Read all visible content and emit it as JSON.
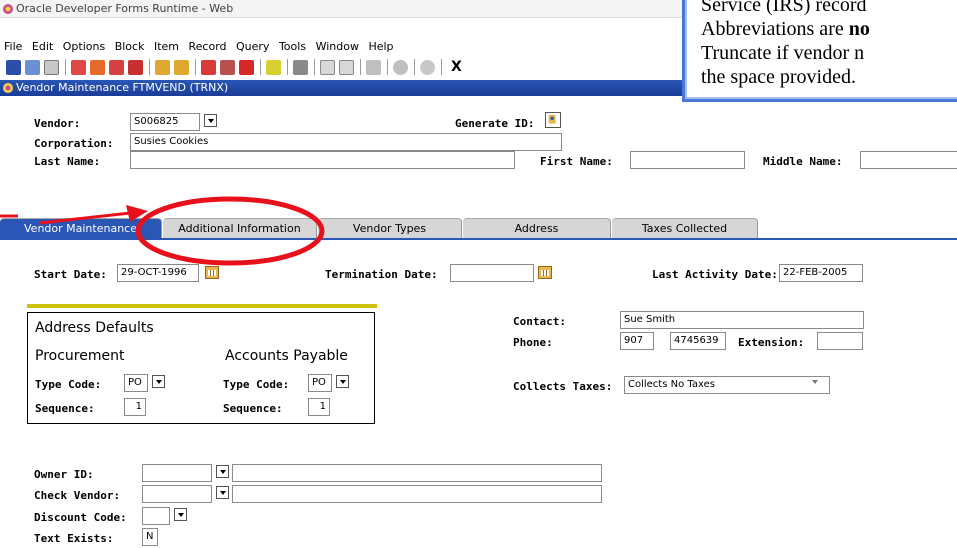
{
  "window": {
    "title": "Oracle Developer Forms Runtime - Web",
    "form_title": "Vendor Maintenance  FTMVEND        (TRNX)"
  },
  "menu": [
    "File",
    "Edit",
    "Options",
    "Block",
    "Item",
    "Record",
    "Query",
    "Tools",
    "Window",
    "Help"
  ],
  "toolbar": {
    "exit_label": "X"
  },
  "callout": {
    "line1": "Service (IRS) record",
    "line2_prefix": "Abbreviations are ",
    "line2_bold": "no",
    "line3": "Truncate if vendor n",
    "line4": "the space provided."
  },
  "header": {
    "vendor_label": "Vendor:",
    "vendor_value": "S006825",
    "generate_id_label": "Generate ID:",
    "corporation_label": "Corporation:",
    "corporation_value": "Susies Cookies",
    "last_name_label": "Last Name:",
    "first_name_label": "First Name:",
    "middle_name_label": "Middle Name:"
  },
  "tabs": [
    {
      "label": "Vendor Maintenance",
      "active": true
    },
    {
      "label": "Additional Information",
      "active": false
    },
    {
      "label": "Vendor Types",
      "active": false
    },
    {
      "label": "Address",
      "active": false
    },
    {
      "label": "Taxes Collected",
      "active": false
    }
  ],
  "dates": {
    "start_label": "Start Date:",
    "start_value": "29-OCT-1996",
    "termination_label": "Termination Date:",
    "last_activity_label": "Last Activity Date:",
    "last_activity_value": "22-FEB-2005"
  },
  "address_defaults": {
    "title": "Address Defaults",
    "procurement": "Procurement",
    "accounts_payable": "Accounts Payable",
    "type_code_label": "Type Code:",
    "sequence_label": "Sequence:",
    "proc_type_code": "PO",
    "proc_sequence": "1",
    "ap_type_code": "PO",
    "ap_sequence": "1"
  },
  "contact": {
    "contact_label": "Contact:",
    "contact_value": "Sue Smith",
    "phone_label": "Phone:",
    "phone_area": "907",
    "phone_number": "4745639",
    "extension_label": "Extension:",
    "collects_taxes_label": "Collects Taxes:",
    "collects_taxes_value": "Collects No Taxes"
  },
  "footer": {
    "owner_id_label": "Owner ID:",
    "check_vendor_label": "Check Vendor:",
    "discount_code_label": "Discount Code:",
    "text_exists_label": "Text Exists:",
    "text_exists_value": "N"
  },
  "colors": {
    "accent_blue": "#2a56b6",
    "highlight_red": "#e8101a",
    "yellow_rule": "#cfc20f"
  }
}
